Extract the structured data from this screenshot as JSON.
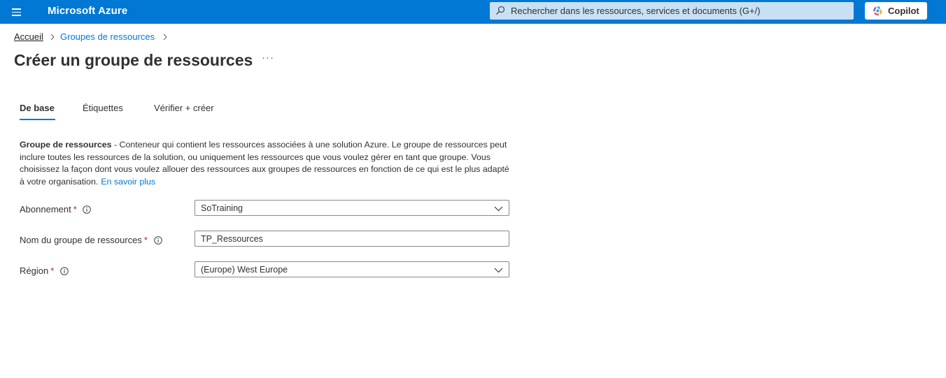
{
  "topbar": {
    "brand": "Microsoft Azure",
    "search_placeholder": "Rechercher dans les ressources, services et documents (G+/)",
    "copilot_label": "Copilot"
  },
  "breadcrumb": {
    "items": [
      "Accueil",
      "Groupes de ressources"
    ]
  },
  "page": {
    "title": "Créer un groupe de ressources",
    "more": "···"
  },
  "tabs": [
    {
      "label": "De base",
      "active": true
    },
    {
      "label": "Étiquettes",
      "active": false
    },
    {
      "label": "Vérifier + créer",
      "active": false
    }
  ],
  "description": {
    "bold": "Groupe de ressources",
    "text": " - Conteneur qui contient les ressources associées à une solution Azure. Le groupe de ressources peut inclure toutes les ressources de la solution, ou uniquement les ressources que vous voulez gérer en tant que groupe. Vous choisissez la façon dont vous voulez allouer des ressources aux groupes de ressources en fonction de ce qui est le plus adapté à votre organisation.",
    "link": "En savoir plus"
  },
  "form": {
    "subscription": {
      "label": "Abonnement",
      "required": "*",
      "value": "SoTraining"
    },
    "rg_name": {
      "label": "Nom du groupe de ressources",
      "required": "*",
      "value": "TP_Ressources"
    },
    "region": {
      "label": "Région",
      "required": "*",
      "value": "(Europe) West Europe"
    }
  },
  "colors": {
    "accent": "#0078d4",
    "required": "#a4262c"
  }
}
